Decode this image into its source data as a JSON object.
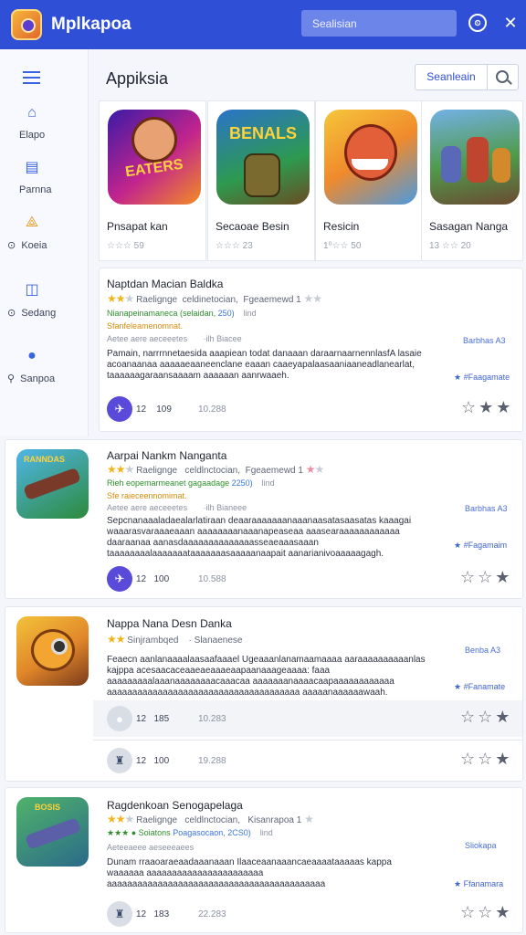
{
  "header": {
    "app_title": "Mplkapoa",
    "search_text": "Sealisian"
  },
  "sidebar": {
    "items": [
      {
        "label": "Elapo",
        "icon": "home-icon"
      },
      {
        "label": "Parnna",
        "icon": "store-icon"
      },
      {
        "label": "Koeia",
        "icon": "shapes-icon"
      },
      {
        "label": "Sedang",
        "icon": "book-icon"
      },
      {
        "label": "Sanpoa",
        "icon": "pin-icon"
      }
    ]
  },
  "main": {
    "section_title": "Appiksia",
    "filter_label": "Seanleain"
  },
  "featured": [
    {
      "name": "Pnsapat kan",
      "rating": "☆☆☆ 59",
      "art_text": "EATERS"
    },
    {
      "name": "Secaoae Besin",
      "rating": "☆☆☆ 23",
      "art_text": "BENALS"
    },
    {
      "name": "Resicin",
      "rating": "1⁰☆☆ 50",
      "art_text": ""
    },
    {
      "name": "Sasagan Nanga",
      "rating": "13 ☆☆ 20",
      "art_text": ""
    }
  ],
  "cards": [
    {
      "title": "Naptdan Macian Baldka",
      "meta": "Raelignge  celdinetocian,  Fgeaemewd 1",
      "green_line": "Nianapeinamaneca (selaidan,",
      "blue_line": "250)",
      "extra": "    lind",
      "orange_line": "Sfanfeleamenomnat.",
      "gray_line": "Aetee aere aeceeetes       ·ilh Biacee",
      "desc": "Pamain, narrrnnetaesida aaapiean todat danaaan daraarnaarnennlasfA lasaie acoanaanaa aaaaaeaaneenclane eaaan caaeyapalaasaaniaaneadlanearlat, taaaaaagaraansaaaam aaaaaan aanrwaaeh.",
      "side_link": "Barbhas A3",
      "side_link2": "★ #Faagamate",
      "foot_avatar": "✈",
      "foot_num": "12    109",
      "foot_num2": "10.288"
    },
    {
      "title": "Aarpai Nankm Nanganta",
      "meta": "Raelignge   celdlnctocian,  Fgeaemewd 1",
      "green_line": "Rieh eopemarmeanet gagaadage",
      "blue_line": "2250)",
      "extra": "    lind",
      "orange_line": "Sfe raieceennomimat.",
      "gray_line": "Aetee aere aeceeetes       ·ilh Bianeee",
      "desc": "Sepcnanaaaladaealarlatiraan deaaraaaaaaanaaanaasatasaasatas kaaagai waaarasvaraaaeaaan aaaaaaaanaaanapeaseaa aaasearaaaaaaaaaaaa daaraanaa aanasdaaaaaaaaaaaaaasseaeaaasaaan taaaaaaaalaaaaaaataaaaaaasaaaaanaapait aanarianivoaaaaagagh.",
      "side_link": "Barbhas A3",
      "side_link2": "★ #Fagamaim",
      "foot_avatar": "✈",
      "foot_num": "12   100",
      "foot_num2": "10.588"
    },
    {
      "title": "Nappa Nana Desn Danka",
      "meta": "Sinjrambqed    · Slanaenese",
      "desc": "Feaecn aanlanaaaalaasaafaaael Ugeaaanlanamaamaaaa aaraaaaaaaaaanlas kajppa acesaacaceaaeaeaaaeaapaanaaageaaaa: faaa aaaaaaaaalaaanaaaaaaaacaaacaa aaaaaaanaaaacaapaaaaaaaaaaaa aaaaaaaaaaaaaaaaaaaaaaaaaaaaaaaaaaaaaa aaaaanaaaaaawaah.",
      "side_link": "Benba A3",
      "side_link2": "★ #Fanamate",
      "foot_num": "12   185",
      "foot_num2": "10.283",
      "extra_foot_num": "12   100",
      "extra_foot_num2": "19.288"
    },
    {
      "title": "Ragdenkoan Senogapelaga",
      "meta": "Raelignge   celdlnctocian,   Kisanrapoa 1",
      "green_line": "★★★ ● Soiatons",
      "blue_line": "Poagasocaon, 2CS0)",
      "extra": "    lind",
      "gray_line": "Aeteeaeee aeseeeaees",
      "desc": "Dunam rraaoaraeaadaaanaaan Ilaaceaanaaancaeaaaataaaaas kappa waaaaaa aaaaaaaaaaaaaaaaaaaaaaa aaaaaaaaaaaaaaaaaaaaaaaaaaaaaaaaaaaaaaaaaaa aaaaaaaaaaaaaaaaaaaaaaaaaaaaaaaaaaaaaaaaaaaaaaaaaa aaaaaaaaaaaaaaaaaaaaaaaaaaaaaaaaaaaaaaaaaa.",
      "side_link": "Sliokapa",
      "side_link2": "★ Ffanamara",
      "foot_num": "12   183",
      "foot_num2": "22.283"
    }
  ],
  "colors": {
    "header": "#2f4fd6",
    "accent": "#3a63df",
    "star": "#f1b41a",
    "green": "#2e8f2e",
    "orange": "#d58c0c",
    "avatar": "#5a4ad9"
  }
}
